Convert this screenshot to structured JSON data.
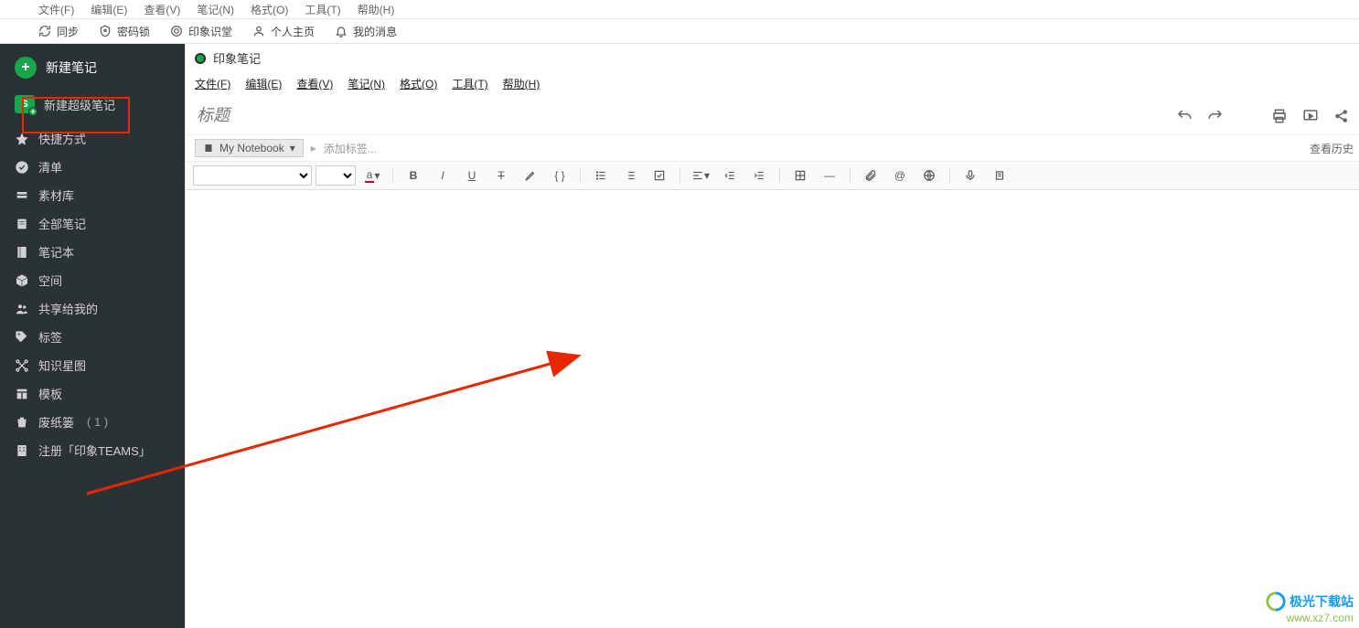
{
  "outer_menubar": [
    "文件(F)",
    "编辑(E)",
    "查看(V)",
    "笔记(N)",
    "格式(O)",
    "工具(T)",
    "帮助(H)"
  ],
  "outer_toolbar": {
    "sync": "同步",
    "lock": "密码锁",
    "class": "印象识堂",
    "home": "个人主页",
    "msg": "我的消息"
  },
  "sidebar": {
    "new_note": "新建笔记",
    "super_note": "新建超级笔记",
    "s_badge": "S",
    "items": [
      {
        "label": "快捷方式"
      },
      {
        "label": "清单"
      },
      {
        "label": "素材库"
      },
      {
        "label": "全部笔记"
      },
      {
        "label": "笔记本"
      },
      {
        "label": "空间"
      },
      {
        "label": "共享给我的"
      },
      {
        "label": "标签"
      },
      {
        "label": "知识星图"
      },
      {
        "label": "模板"
      },
      {
        "label": "废纸篓",
        "count": "( 1 )"
      },
      {
        "label": "注册「印象TEAMS」"
      }
    ]
  },
  "editor": {
    "app_title": "印象笔记",
    "menubar": [
      "文件(F)",
      "编辑(E)",
      "查看(V)",
      "笔记(N)",
      "格式(O)",
      "工具(T)",
      "帮助(H)"
    ],
    "title_placeholder": "标题",
    "notebook_label": "My Notebook",
    "tag_placeholder": "添加标签...",
    "history": "查看历史"
  },
  "watermark": {
    "line1": "极光下载站",
    "line2": "www.xz7.com"
  }
}
